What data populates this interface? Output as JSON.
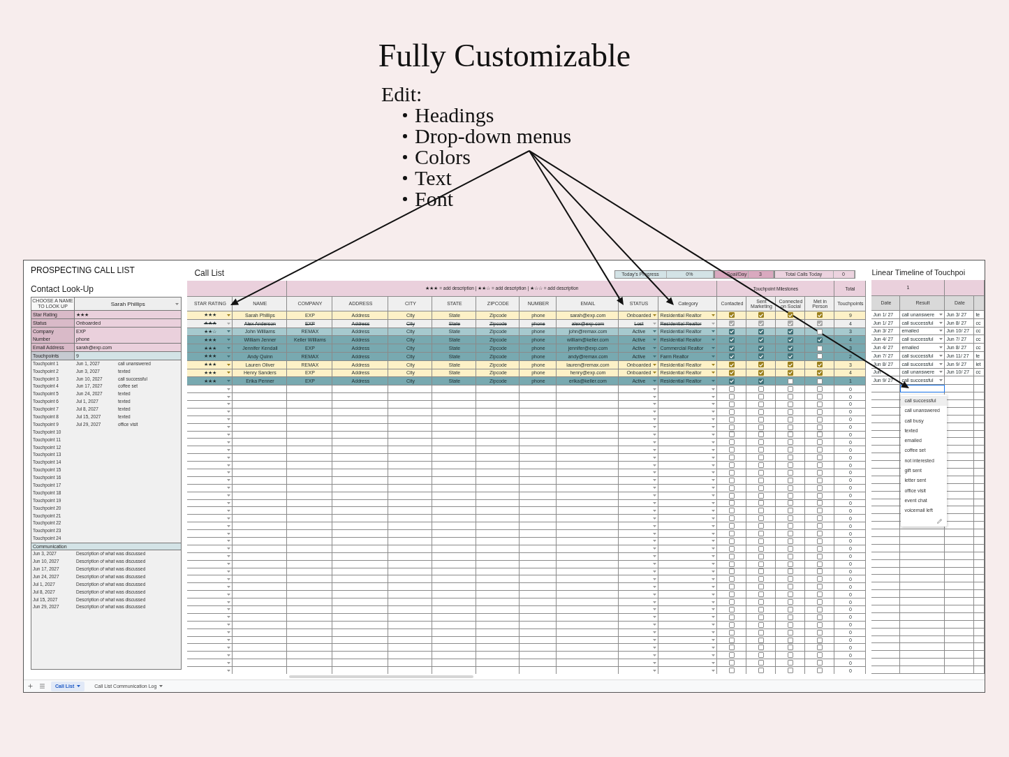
{
  "heading": {
    "title": "Fully Customizable",
    "edit_label": "Edit:",
    "items": [
      "Headings",
      "Drop-down menus",
      "Colors",
      "Text",
      "Font"
    ]
  },
  "left_panel": {
    "title": "PROSPECTING CALL LIST",
    "subtitle": "Contact Look-Up",
    "lookup_label": "CHOOSE A NAME TO LOOK UP",
    "lookup_value": "Sarah Phillips",
    "fields": [
      {
        "label": "Star Rating",
        "value": "★★★",
        "color": "#ead0dc"
      },
      {
        "label": "Status",
        "value": "Onboarded",
        "color": "#ead0dc"
      },
      {
        "label": "Company",
        "value": "EXP",
        "color": "#ead0dc"
      },
      {
        "label": "Number",
        "value": "phone",
        "color": "#ead0dc"
      },
      {
        "label": "Email Address",
        "value": "sarah@exp.com",
        "color": "#ead0dc"
      },
      {
        "label": "Touchpoints",
        "value": "9",
        "color": "#d3e3e6"
      }
    ],
    "touchpoints": [
      {
        "label": "Touchpoint 1",
        "date": "Jun 1, 2027",
        "result": "call unanswered"
      },
      {
        "label": "Touchpoint 2",
        "date": "Jun 3, 2027",
        "result": "texted"
      },
      {
        "label": "Touchpoint 3",
        "date": "Jun 10, 2027",
        "result": "call successful"
      },
      {
        "label": "Touchpoint 4",
        "date": "Jun 17, 2027",
        "result": "coffee set"
      },
      {
        "label": "Touchpoint 5",
        "date": "Jun 24, 2027",
        "result": "texted"
      },
      {
        "label": "Touchpoint 6",
        "date": "Jul 1, 2027",
        "result": "texted"
      },
      {
        "label": "Touchpoint 7",
        "date": "Jul 8, 2027",
        "result": "texted"
      },
      {
        "label": "Touchpoint 8",
        "date": "Jul 15, 2027",
        "result": "texted"
      },
      {
        "label": "Touchpoint 9",
        "date": "Jul 29, 2027",
        "result": "office visit"
      },
      {
        "label": "Touchpoint 10"
      },
      {
        "label": "Touchpoint 11"
      },
      {
        "label": "Touchpoint 12"
      },
      {
        "label": "Touchpoint 13"
      },
      {
        "label": "Touchpoint 14"
      },
      {
        "label": "Touchpoint 15"
      },
      {
        "label": "Touchpoint 16"
      },
      {
        "label": "Touchpoint 17"
      },
      {
        "label": "Touchpoint 18"
      },
      {
        "label": "Touchpoint 19"
      },
      {
        "label": "Touchpoint 20"
      },
      {
        "label": "Touchpoint 21"
      },
      {
        "label": "Touchpoint 22"
      },
      {
        "label": "Touchpoint 23"
      },
      {
        "label": "Touchpoint 24"
      }
    ],
    "communication_label": "Communication",
    "communications": [
      {
        "date": "Jun 3, 2027",
        "text": "Description of what was discussed"
      },
      {
        "date": "Jun 10, 2027",
        "text": "Description of what was discussed"
      },
      {
        "date": "Jun 17, 2027",
        "text": "Description of what was discussed"
      },
      {
        "date": "Jun 24, 2027",
        "text": "Description of what was discussed"
      },
      {
        "date": "Jul 1, 2027",
        "text": "Description of what was discussed"
      },
      {
        "date": "Jul 8, 2027",
        "text": "Description of what was discussed"
      },
      {
        "date": "Jul 15, 2027",
        "text": "Description of what was discussed"
      },
      {
        "date": "Jun 29, 2027",
        "text": "Description of what was discussed"
      }
    ]
  },
  "call_list": {
    "title": "Call List",
    "progress": [
      {
        "label": "Today's Progress",
        "value": "0%",
        "color": "#d3e3e6"
      },
      {
        "label": "Goal/Day",
        "value": "3",
        "color": "#d9a9bf"
      },
      {
        "label": "Total Calls Today",
        "value": "0",
        "color": "#ecd3df"
      }
    ],
    "legend": "★★★ = add description | ★★☆ = add description | ★☆☆ = add description",
    "milestones_label": "Touchpoint Milestones",
    "total_label": "Total",
    "columns": [
      "STAR RATING",
      "NAME",
      "COMPANY",
      "ADDRESS",
      "CITY",
      "STATE",
      "ZIPCODE",
      "NUMBER",
      "EMAIL",
      "STATUS",
      "Category",
      "Contacted",
      "Sent Marketing",
      "Connected on Social",
      "Met in Person",
      "Touchpoints"
    ],
    "rows": [
      {
        "rating": "★★★",
        "name": "Sarah Phillips",
        "company": "EXP",
        "address": "Address",
        "city": "City",
        "state": "State",
        "zipcode": "Zipcode",
        "number": "phone",
        "email": "sarah@exp.com",
        "status": "Onboarded",
        "category": "Residential Realtor",
        "milestones": [
          true,
          true,
          true,
          true
        ],
        "total": "9",
        "color": "#fdf1c7",
        "struck": false
      },
      {
        "rating": "★★★",
        "name": "Alex Anderson",
        "company": "EXP",
        "address": "Address",
        "city": "City",
        "state": "State",
        "zipcode": "Zipcode",
        "number": "phone",
        "email": "alex@exp.com",
        "status": "Lost",
        "category": "Residential Realtor",
        "milestones": [
          true,
          true,
          true,
          true
        ],
        "total": "4",
        "color": "#efefef",
        "struck": true
      },
      {
        "rating": "★★☆",
        "name": "John Williams",
        "company": "REMAX",
        "address": "Address",
        "city": "City",
        "state": "State",
        "zipcode": "Zipcode",
        "number": "phone",
        "email": "john@remax.com",
        "status": "Active",
        "category": "Residential Realtor",
        "milestones": [
          true,
          true,
          true,
          false
        ],
        "total": "3",
        "color": "#a6c9ce",
        "struck": false
      },
      {
        "rating": "★★★",
        "name": "William Jenner",
        "company": "Keller Williams",
        "address": "Address",
        "city": "City",
        "state": "State",
        "zipcode": "Zipcode",
        "number": "phone",
        "email": "william@keller.com",
        "status": "Active",
        "category": "Residential Realtor",
        "milestones": [
          true,
          true,
          true,
          true
        ],
        "total": "4",
        "color": "#78a9b0",
        "struck": false
      },
      {
        "rating": "★★★",
        "name": "Jennifer Kendall",
        "company": "EXP",
        "address": "Address",
        "city": "City",
        "state": "State",
        "zipcode": "Zipcode",
        "number": "phone",
        "email": "jennifer@exp.com",
        "status": "Active",
        "category": "Commercial Realtor",
        "milestones": [
          true,
          true,
          true,
          false
        ],
        "total": "3",
        "color": "#78a9b0",
        "struck": false
      },
      {
        "rating": "★★★",
        "name": "Andy Quinn",
        "company": "REMAX",
        "address": "Address",
        "city": "City",
        "state": "State",
        "zipcode": "Zipcode",
        "number": "phone",
        "email": "andy@remax.com",
        "status": "Active",
        "category": "Farm Realtor",
        "milestones": [
          true,
          true,
          true,
          false
        ],
        "total": "2",
        "color": "#78a9b0",
        "struck": false
      },
      {
        "rating": "★★★",
        "name": "Lauren Oliver",
        "company": "REMAX",
        "address": "Address",
        "city": "City",
        "state": "State",
        "zipcode": "Zipcode",
        "number": "phone",
        "email": "lauren@remax.com",
        "status": "Onboarded",
        "category": "Residential Realtor",
        "milestones": [
          true,
          true,
          true,
          true
        ],
        "total": "3",
        "color": "#fdf1c7",
        "struck": false
      },
      {
        "rating": "★★★",
        "name": "Henry Sanders",
        "company": "EXP",
        "address": "Address",
        "city": "City",
        "state": "State",
        "zipcode": "Zipcode",
        "number": "phone",
        "email": "henry@exp.com",
        "status": "Onboarded",
        "category": "Residential Realtor",
        "milestones": [
          true,
          true,
          true,
          true
        ],
        "total": "4",
        "color": "#fdf1c7",
        "struck": false
      },
      {
        "rating": "★★★",
        "name": "Erika Penner",
        "company": "EXP",
        "address": "Address",
        "city": "City",
        "state": "State",
        "zipcode": "Zipcode",
        "number": "phone",
        "email": "erika@keller.com",
        "status": "Active",
        "category": "Residential Realtor",
        "milestones": [
          true,
          true,
          false,
          false
        ],
        "total": "1",
        "color": "#78a9b0",
        "struck": false
      }
    ],
    "empty_rows": [
      {
        "total": "0",
        "milestones": [
          false,
          false,
          false,
          false
        ]
      },
      {
        "total": "0",
        "milestones": [
          false,
          false,
          false,
          false
        ]
      },
      {
        "total": "0",
        "milestones": [
          false,
          false,
          false,
          false
        ]
      },
      {
        "total": "0",
        "milestones": [
          false,
          false,
          false,
          false
        ]
      },
      {
        "total": "0",
        "milestones": [
          false,
          false,
          false,
          false
        ]
      },
      {
        "total": "0",
        "milestones": [
          false,
          false,
          false,
          false
        ]
      },
      {
        "total": "0",
        "milestones": [
          false,
          false,
          false,
          false
        ]
      },
      {
        "total": "0",
        "milestones": [
          false,
          false,
          false,
          false
        ]
      },
      {
        "total": "0",
        "milestones": [
          false,
          false,
          false,
          false
        ]
      },
      {
        "total": "0",
        "milestones": [
          false,
          false,
          false,
          false
        ]
      },
      {
        "total": "0",
        "milestones": [
          false,
          false,
          false,
          false
        ]
      },
      {
        "total": "0",
        "milestones": [
          false,
          false,
          false,
          false
        ]
      },
      {
        "total": "0",
        "milestones": [
          false,
          false,
          false,
          false
        ]
      },
      {
        "total": "0",
        "milestones": [
          false,
          false,
          false,
          false
        ]
      },
      {
        "total": "0",
        "milestones": [
          false,
          false,
          false,
          false
        ]
      },
      {
        "total": "0",
        "milestones": [
          false,
          false,
          false,
          false
        ]
      },
      {
        "total": "0",
        "milestones": [
          false,
          false,
          false,
          false
        ]
      },
      {
        "total": "0",
        "milestones": [
          false,
          false,
          false,
          false
        ]
      },
      {
        "total": "0",
        "milestones": [
          false,
          false,
          false,
          false
        ]
      },
      {
        "total": "0",
        "milestones": [
          false,
          false,
          false,
          false
        ]
      },
      {
        "total": "0",
        "milestones": [
          false,
          false,
          false,
          false
        ]
      },
      {
        "total": "0",
        "milestones": [
          false,
          false,
          false,
          false
        ]
      },
      {
        "total": "0",
        "milestones": [
          false,
          false,
          false,
          false
        ]
      },
      {
        "total": "0",
        "milestones": [
          false,
          false,
          false,
          false
        ]
      },
      {
        "total": "0",
        "milestones": [
          false,
          false,
          false,
          false
        ]
      },
      {
        "total": "0",
        "milestones": [
          false,
          false,
          false,
          false
        ]
      },
      {
        "total": "0",
        "milestones": [
          false,
          false,
          false,
          false
        ]
      },
      {
        "total": "0",
        "milestones": [
          false,
          false,
          false,
          false
        ]
      },
      {
        "total": "0",
        "milestones": [
          false,
          false,
          false,
          false
        ]
      },
      {
        "total": "0",
        "milestones": [
          false,
          false,
          false,
          false
        ]
      },
      {
        "total": "0",
        "milestones": [
          false,
          false,
          false,
          false
        ]
      },
      {
        "total": "0",
        "milestones": [
          false,
          false,
          false,
          false
        ]
      },
      {
        "total": "0",
        "milestones": [
          false,
          false,
          false,
          false
        ]
      },
      {
        "total": "0",
        "milestones": [
          false,
          false,
          false,
          false
        ]
      },
      {
        "total": "0",
        "milestones": [
          false,
          false,
          false,
          false
        ]
      },
      {
        "total": "0",
        "milestones": [
          false,
          false,
          false,
          false
        ]
      },
      {
        "total": "0",
        "milestones": [
          false,
          false,
          false,
          false
        ]
      },
      {
        "total": "0",
        "milestones": [
          false,
          false,
          false,
          false
        ]
      }
    ]
  },
  "timeline": {
    "title": "Linear Timeline of Touchpoi",
    "group_label": "1",
    "columns": [
      "Date",
      "Result",
      "Date"
    ],
    "rows": [
      {
        "date": "Jun 1/ 27",
        "result": "call unanswere",
        "date_2": "Jun 3/ 27",
        "column_4": "te"
      },
      {
        "date": "Jun 1/ 27",
        "result": "call successful",
        "date_2": "Jun 8/ 27",
        "column_4": "cc"
      },
      {
        "date": "Jun 3/ 27",
        "result": "emailed",
        "date_2": "Jun 10/ 27",
        "column_4": "cc"
      },
      {
        "date": "Jun 4/ 27",
        "result": "call successful",
        "date_2": "Jun 7/ 27",
        "column_4": "cc"
      },
      {
        "date": "Jun 4/ 27",
        "result": "emailed",
        "date_2": "Jun 8/ 27",
        "column_4": "cc"
      },
      {
        "date": "Jun 7/ 27",
        "result": "call successful",
        "date_2": "Jun 11/ 27",
        "column_4": "te"
      },
      {
        "date": "Jun 8/ 27",
        "result": "call successful",
        "date_2": "Jun 9/ 27",
        "column_4": "let"
      },
      {
        "date": "Jun",
        "result": "call unanswere",
        "date_2": "Jun 10/ 27",
        "column_4": "cc"
      },
      {
        "date": "Jun 9/ 27",
        "result": "call successful"
      }
    ],
    "dropdown": {
      "options": [
        {
          "label": "call successful",
          "selected": true
        },
        {
          "label": "call unanswered",
          "selected": false
        },
        {
          "label": "call busy",
          "selected": false
        },
        {
          "label": "texted",
          "selected": false
        },
        {
          "label": "emailed",
          "selected": false
        },
        {
          "label": "coffee set",
          "selected": false
        },
        {
          "label": "not interested",
          "selected": false
        },
        {
          "label": "gift sent",
          "selected": false
        },
        {
          "label": "letter sent",
          "selected": false
        },
        {
          "label": "office visit",
          "selected": false
        },
        {
          "label": "event chat",
          "selected": false
        },
        {
          "label": "voicemail left",
          "selected": false
        }
      ]
    }
  },
  "sheet_tabs": [
    {
      "label": "Call List",
      "selected": true
    },
    {
      "label": "Call List Communication Log",
      "selected": false
    }
  ]
}
